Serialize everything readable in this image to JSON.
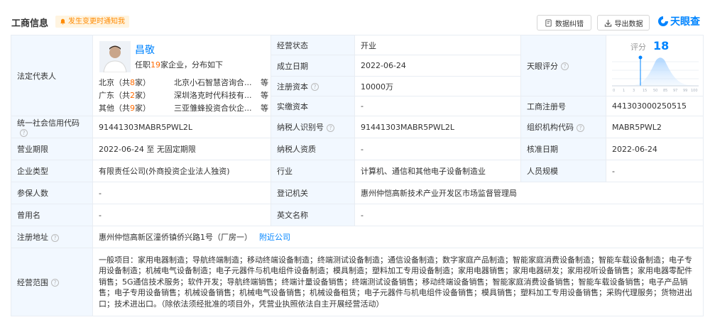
{
  "header": {
    "title": "工商信息",
    "notify_label": "发生变更时通知我",
    "correct_label": "数据纠错",
    "export_label": "导出数据",
    "brand": "天眼查"
  },
  "legal_rep": {
    "label": "法定代表人",
    "name": "昌敬",
    "sub_prefix": "任职",
    "sub_num": "19",
    "sub_suffix": "家企业，分布如下",
    "regions": [
      {
        "prefix": "北京（共",
        "num": "8",
        "suffix": "家）",
        "company": "北京小石智慧咨询合...",
        "etc": "等"
      },
      {
        "prefix": "广东（共",
        "num": "2",
        "suffix": "家）",
        "company": "深圳洛克时代科技有...",
        "etc": "等"
      },
      {
        "prefix": "其他（共",
        "num": "9",
        "suffix": "家）",
        "company": "三亚雏蜂投资合伙企...",
        "etc": "等"
      }
    ]
  },
  "fields": {
    "status_label": "经营状态",
    "status": "开业",
    "founded_label": "成立日期",
    "founded": "2022-06-24",
    "capital_label": "注册资本",
    "capital": "10000万",
    "paid_label": "实缴资本",
    "paid": "-",
    "score_label": "天眼评分",
    "score_prefix": "评分",
    "score": "18",
    "regno_label": "工商注册号",
    "regno": "441303000250515",
    "uscc_label": "统一社会信用代码",
    "uscc": "91441303MABR5PWL2L",
    "taxid_label": "纳税人识别号",
    "taxid": "91441303MABR5PWL2L",
    "orgcode_label": "组织机构代码",
    "orgcode": "MABR5PWL2",
    "term_label": "营业期限",
    "term": "2022-06-24 至 无固定期限",
    "taxq_label": "纳税人资质",
    "taxq": "-",
    "approve_label": "核准日期",
    "approve": "2022-06-24",
    "type_label": "企业类型",
    "type": "有限责任公司(外商投资企业法人独资)",
    "industry_label": "行业",
    "industry": "计算机、通信和其他电子设备制造业",
    "staff_label": "人员规模",
    "staff": "-",
    "insured_label": "参保人数",
    "insured": "-",
    "authority_label": "登记机关",
    "authority": "惠州仲恺高新技术产业开发区市场监督管理局",
    "former_label": "曾用名",
    "former": "-",
    "english_label": "英文名称",
    "english": "-",
    "address_label": "注册地址",
    "address": "惠州仲恺高新区潼侨镇侨兴路1号（厂房一）",
    "address_link": "附近公司",
    "scope_label": "经营范围",
    "scope": "一般项目：家用电器制造；导航终端制造；移动终端设备制造；终端测试设备制造；通信设备制造；数字家庭产品制造；智能家庭消费设备制造；智能车载设备制造；电子专用设备制造；机械电气设备制造；电子元器件与机电组件设备制造；模具制造；塑料加工专用设备制造；家用电器销售；家用电器研发；家用视听设备销售；家用电器零配件销售；5G通信技术服务；软件开发；导航终端销售；终端计量设备销售；终端测试设备销售；移动终端设备销售；智能家庭消费设备销售；智能车载设备销售；电子产品销售；电子专用设备销售；机械设备销售；机械电气设备销售；机械设备租赁；电子元器件与机电组件设备销售；模具销售；塑料加工专用设备销售；采购代理服务；货物进出口；技术进出口。（除依法须经批准的项目外，凭营业执照依法自主开展经营活动）"
  },
  "score_axis": [
    "0",
    "1",
    "3",
    "15",
    "50",
    "85",
    "97",
    "99",
    "100"
  ],
  "colors": {
    "accent": "#0084ff",
    "highlight": "#ff6a00",
    "label_bg": "#f2f8ff"
  }
}
